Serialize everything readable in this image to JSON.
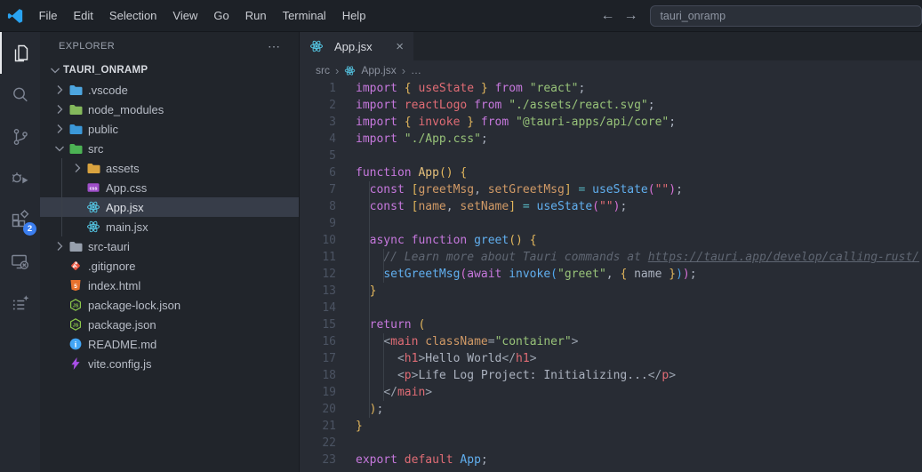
{
  "title_bar": {
    "menus": [
      "File",
      "Edit",
      "Selection",
      "View",
      "Go",
      "Run",
      "Terminal",
      "Help"
    ],
    "back_icon": "←",
    "forward_icon": "→",
    "search_value": "tauri_onramp"
  },
  "activity_bar": {
    "items": [
      {
        "name": "explorer",
        "icon": "files-icon",
        "active": true
      },
      {
        "name": "search",
        "icon": "search-icon",
        "active": false
      },
      {
        "name": "source-control",
        "icon": "source-control-icon",
        "active": false
      },
      {
        "name": "run-debug",
        "icon": "debug-icon",
        "active": false
      },
      {
        "name": "extensions",
        "icon": "extensions-icon",
        "active": false,
        "badge": "2"
      },
      {
        "name": "remote-explorer",
        "icon": "remote-icon",
        "active": false
      },
      {
        "name": "checklist",
        "icon": "list-sparkle-icon",
        "active": false
      }
    ]
  },
  "sidebar": {
    "header": "EXPLORER",
    "more_icon": "⋯",
    "root": {
      "label": "TAURI_ONRAMP",
      "expanded": true
    },
    "tree": [
      {
        "label": ".vscode",
        "icon": "folder-icon",
        "color": "#4da6e0",
        "chevron": "right",
        "indent": 1
      },
      {
        "label": "node_modules",
        "icon": "folder-icon",
        "color": "#84b95c",
        "chevron": "right",
        "indent": 1
      },
      {
        "label": "public",
        "icon": "folder-icon",
        "color": "#3b98d8",
        "chevron": "right",
        "indent": 1
      },
      {
        "label": "src",
        "icon": "folder-icon",
        "color": "#4cb354",
        "chevron": "down",
        "indent": 1
      },
      {
        "label": "assets",
        "icon": "folder-icon",
        "color": "#d9a33f",
        "chevron": "right",
        "indent": 2
      },
      {
        "label": "App.css",
        "icon": "css-icon",
        "color": "#9f4fc9",
        "indent": 2,
        "file": true
      },
      {
        "label": "App.jsx",
        "icon": "react-icon",
        "color": "#53c1de",
        "indent": 2,
        "file": true,
        "selected": true
      },
      {
        "label": "main.jsx",
        "icon": "react-icon",
        "color": "#53c1de",
        "indent": 2,
        "file": true
      },
      {
        "label": "src-tauri",
        "icon": "folder-icon",
        "color": "#97a0ad",
        "chevron": "right",
        "indent": 1
      },
      {
        "label": ".gitignore",
        "icon": "git-icon",
        "color": "#e8543f",
        "indent": 1,
        "file": true
      },
      {
        "label": "index.html",
        "icon": "html-icon",
        "color": "#e8722e",
        "indent": 1,
        "file": true
      },
      {
        "label": "package-lock.json",
        "icon": "node-icon",
        "color": "#8cc84b",
        "indent": 1,
        "file": true
      },
      {
        "label": "package.json",
        "icon": "node-icon",
        "color": "#8cc84b",
        "indent": 1,
        "file": true
      },
      {
        "label": "README.md",
        "icon": "info-icon",
        "color": "#42a5f5",
        "indent": 1,
        "file": true
      },
      {
        "label": "vite.config.js",
        "icon": "bolt-icon",
        "color": "#a94fe8",
        "indent": 1,
        "file": true
      }
    ]
  },
  "editor": {
    "tab": {
      "label": "App.jsx",
      "icon": "react-icon",
      "icon_color": "#53c1de",
      "close": "×"
    },
    "breadcrumb": {
      "items": [
        "src",
        "App.jsx",
        "…"
      ],
      "separator": "›"
    },
    "code": {
      "palette": {
        "kw": "#c678dd",
        "red": "#e06c75",
        "org": "#d19a66",
        "yl": "#e5c07b",
        "y": "#e2b65c",
        "pk": "#d670d6",
        "lb": "#4fa6ed",
        "blue": "#61afef",
        "cy": "#56b6c2",
        "grn": "#98c379",
        "sred": "#e06c75",
        "t": "#abb2bf",
        "pn": "#9aa2ae",
        "cm": "#5f6672",
        "url": "#5f6672"
      },
      "lines": [
        {
          "n": 1,
          "t": [
            [
              "kw",
              "import"
            ],
            [
              "t",
              " "
            ],
            [
              "y",
              "{"
            ],
            [
              "t",
              " "
            ],
            [
              "red",
              "useState"
            ],
            [
              "t",
              " "
            ],
            [
              "y",
              "}"
            ],
            [
              "t",
              " "
            ],
            [
              "kw",
              "from"
            ],
            [
              "t",
              " "
            ],
            [
              "grn",
              "\"react\""
            ],
            [
              "t",
              ";"
            ]
          ]
        },
        {
          "n": 2,
          "t": [
            [
              "kw",
              "import"
            ],
            [
              "t",
              " "
            ],
            [
              "red",
              "reactLogo"
            ],
            [
              "t",
              " "
            ],
            [
              "kw",
              "from"
            ],
            [
              "t",
              " "
            ],
            [
              "grn",
              "\"./assets/react.svg\""
            ],
            [
              "t",
              ";"
            ]
          ]
        },
        {
          "n": 3,
          "t": [
            [
              "kw",
              "import"
            ],
            [
              "t",
              " "
            ],
            [
              "y",
              "{"
            ],
            [
              "t",
              " "
            ],
            [
              "red",
              "invoke"
            ],
            [
              "t",
              " "
            ],
            [
              "y",
              "}"
            ],
            [
              "t",
              " "
            ],
            [
              "kw",
              "from"
            ],
            [
              "t",
              " "
            ],
            [
              "grn",
              "\"@tauri-apps/api/core\""
            ],
            [
              "t",
              ";"
            ]
          ]
        },
        {
          "n": 4,
          "t": [
            [
              "kw",
              "import"
            ],
            [
              "t",
              " "
            ],
            [
              "grn",
              "\"./App.css\""
            ],
            [
              "t",
              ";"
            ]
          ]
        },
        {
          "n": 5,
          "t": []
        },
        {
          "n": 6,
          "t": [
            [
              "kw",
              "function"
            ],
            [
              "t",
              " "
            ],
            [
              "yl",
              "App"
            ],
            [
              "y",
              "()"
            ],
            [
              "t",
              " "
            ],
            [
              "y",
              "{"
            ]
          ]
        },
        {
          "n": 7,
          "t": [
            [
              "t",
              "  "
            ],
            [
              "kw",
              "const"
            ],
            [
              "t",
              " "
            ],
            [
              "y",
              "["
            ],
            [
              "org",
              "greetMsg"
            ],
            [
              "t",
              ", "
            ],
            [
              "org",
              "setGreetMsg"
            ],
            [
              "y",
              "]"
            ],
            [
              "t",
              " "
            ],
            [
              "cy",
              "="
            ],
            [
              "t",
              " "
            ],
            [
              "blue",
              "useState"
            ],
            [
              "pk",
              "("
            ],
            [
              "sred",
              "\"\""
            ],
            [
              "pk",
              ")"
            ],
            [
              "t",
              ";"
            ]
          ]
        },
        {
          "n": 8,
          "t": [
            [
              "t",
              "  "
            ],
            [
              "kw",
              "const"
            ],
            [
              "t",
              " "
            ],
            [
              "y",
              "["
            ],
            [
              "org",
              "name"
            ],
            [
              "t",
              ", "
            ],
            [
              "org",
              "setName"
            ],
            [
              "y",
              "]"
            ],
            [
              "t",
              " "
            ],
            [
              "cy",
              "="
            ],
            [
              "t",
              " "
            ],
            [
              "blue",
              "useState"
            ],
            [
              "pk",
              "("
            ],
            [
              "sred",
              "\"\""
            ],
            [
              "pk",
              ")"
            ],
            [
              "t",
              ";"
            ]
          ]
        },
        {
          "n": 9,
          "t": []
        },
        {
          "n": 10,
          "t": [
            [
              "t",
              "  "
            ],
            [
              "kw",
              "async"
            ],
            [
              "t",
              " "
            ],
            [
              "kw",
              "function"
            ],
            [
              "t",
              " "
            ],
            [
              "blue",
              "greet"
            ],
            [
              "y",
              "()"
            ],
            [
              "t",
              " "
            ],
            [
              "y",
              "{"
            ]
          ]
        },
        {
          "n": 11,
          "t": [
            [
              "t",
              "    "
            ],
            [
              "cm",
              "// Learn more about Tauri commands at "
            ],
            [
              "url",
              "https://tauri.app/develop/calling-rust/"
            ]
          ]
        },
        {
          "n": 12,
          "t": [
            [
              "t",
              "    "
            ],
            [
              "blue",
              "setGreetMsg"
            ],
            [
              "pk",
              "("
            ],
            [
              "kw",
              "await"
            ],
            [
              "t",
              " "
            ],
            [
              "blue",
              "invoke"
            ],
            [
              "lb",
              "("
            ],
            [
              "grn",
              "\"greet\""
            ],
            [
              "t",
              ", "
            ],
            [
              "y",
              "{"
            ],
            [
              "t",
              " name "
            ],
            [
              "y",
              "}"
            ],
            [
              "lb",
              ")"
            ],
            [
              "pk",
              ")"
            ],
            [
              "t",
              ";"
            ]
          ]
        },
        {
          "n": 13,
          "t": [
            [
              "t",
              "  "
            ],
            [
              "y",
              "}"
            ]
          ]
        },
        {
          "n": 14,
          "t": []
        },
        {
          "n": 15,
          "t": [
            [
              "t",
              "  "
            ],
            [
              "kw",
              "return"
            ],
            [
              "t",
              " "
            ],
            [
              "y",
              "("
            ]
          ]
        },
        {
          "n": 16,
          "t": [
            [
              "t",
              "    "
            ],
            [
              "pn",
              "<"
            ],
            [
              "red",
              "main"
            ],
            [
              "t",
              " "
            ],
            [
              "org",
              "className"
            ],
            [
              "pn",
              "="
            ],
            [
              "grn",
              "\"container\""
            ],
            [
              "pn",
              ">"
            ]
          ]
        },
        {
          "n": 17,
          "t": [
            [
              "t",
              "      "
            ],
            [
              "pn",
              "<"
            ],
            [
              "red",
              "h1"
            ],
            [
              "pn",
              ">"
            ],
            [
              "t",
              "Hello World"
            ],
            [
              "pn",
              "</"
            ],
            [
              "red",
              "h1"
            ],
            [
              "pn",
              ">"
            ]
          ]
        },
        {
          "n": 18,
          "t": [
            [
              "t",
              "      "
            ],
            [
              "pn",
              "<"
            ],
            [
              "red",
              "p"
            ],
            [
              "pn",
              ">"
            ],
            [
              "t",
              "Life Log Project: Initializing..."
            ],
            [
              "pn",
              "</"
            ],
            [
              "red",
              "p"
            ],
            [
              "pn",
              ">"
            ]
          ]
        },
        {
          "n": 19,
          "t": [
            [
              "t",
              "    "
            ],
            [
              "pn",
              "</"
            ],
            [
              "red",
              "main"
            ],
            [
              "pn",
              ">"
            ]
          ]
        },
        {
          "n": 20,
          "t": [
            [
              "t",
              "  "
            ],
            [
              "y",
              ")"
            ],
            [
              "t",
              ";"
            ]
          ]
        },
        {
          "n": 21,
          "t": [
            [
              "y",
              "}"
            ]
          ]
        },
        {
          "n": 22,
          "t": []
        },
        {
          "n": 23,
          "t": [
            [
              "kw",
              "export"
            ],
            [
              "t",
              " "
            ],
            [
              "red",
              "default"
            ],
            [
              "t",
              " "
            ],
            [
              "blue",
              "App"
            ],
            [
              "t",
              ";"
            ]
          ]
        }
      ]
    }
  },
  "colors": {
    "accent_badge": "#3b7ef0",
    "titlebar_bg": "#1d2127",
    "sidebar_bg": "#21252b",
    "editor_bg": "#282c34",
    "selection_bg": "#373d49",
    "logo_blue": "#29a3f1"
  }
}
